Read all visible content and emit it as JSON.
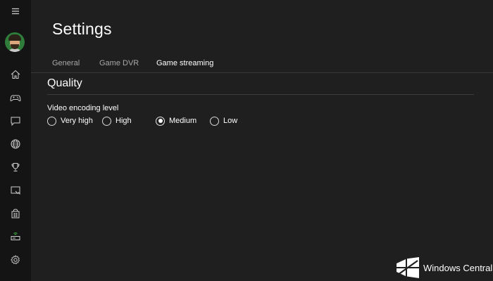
{
  "nav": {
    "items": [
      {
        "name": "menu",
        "icon": "hamburger-icon"
      },
      {
        "name": "profile",
        "icon": "avatar"
      },
      {
        "name": "home",
        "icon": "home-icon"
      },
      {
        "name": "games",
        "icon": "controller-icon"
      },
      {
        "name": "messages",
        "icon": "chat-icon"
      },
      {
        "name": "social",
        "icon": "globe-icon"
      },
      {
        "name": "achievements",
        "icon": "trophy-icon"
      },
      {
        "name": "game-dvr",
        "icon": "game-dvr-icon"
      },
      {
        "name": "store",
        "icon": "store-icon"
      },
      {
        "name": "connect",
        "icon": "console-connect-icon"
      },
      {
        "name": "settings",
        "icon": "gear-icon"
      }
    ]
  },
  "page": {
    "title": "Settings"
  },
  "tabs": [
    {
      "label": "General",
      "active": false
    },
    {
      "label": "Game DVR",
      "active": false
    },
    {
      "label": "Game streaming",
      "active": true
    }
  ],
  "quality": {
    "section_title": "Quality",
    "field_label": "Video encoding level",
    "options": [
      {
        "label": "Very high",
        "checked": false
      },
      {
        "label": "High",
        "checked": false
      },
      {
        "label": "Medium",
        "checked": true
      },
      {
        "label": "Low",
        "checked": false
      }
    ]
  },
  "watermark": {
    "text": "Windows Central"
  },
  "colors": {
    "background": "#1f1f1f",
    "rail": "#141414",
    "text": "#ffffff",
    "muted_text": "#a8a8a8",
    "connect_accent": "#3fbf3f"
  }
}
